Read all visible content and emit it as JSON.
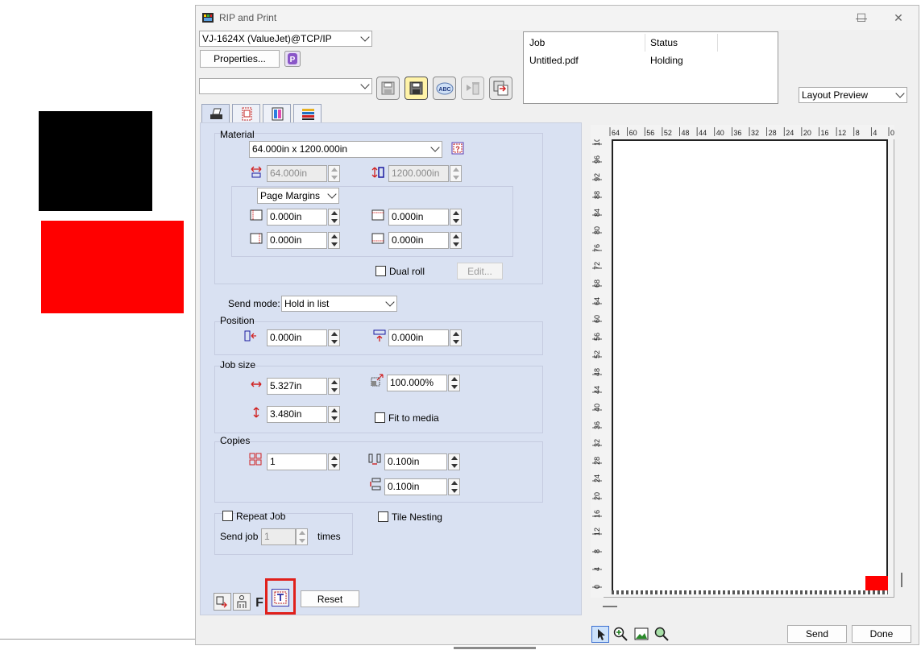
{
  "window": {
    "title": "RIP and Print",
    "controls": {
      "minimize": "—",
      "maximize": "☐",
      "close": "✕"
    }
  },
  "printer": {
    "selected": "VJ-1624X (ValueJet)@TCP/IP"
  },
  "properties_button": "Properties...",
  "settings_combo": {
    "selected": ""
  },
  "job_list": {
    "headers": [
      "Job",
      "Status"
    ],
    "rows": [
      {
        "job": "Untitled.pdf",
        "status": "Holding"
      }
    ]
  },
  "preview_mode": {
    "selected": "Layout Preview"
  },
  "material": {
    "label": "Material",
    "size": "64.000in x 1200.000in",
    "width": "64.000in",
    "height": "1200.000in",
    "margins_mode": "Page Margins",
    "margin_left": "0.000in",
    "margin_top": "0.000in",
    "margin_right": "0.000in",
    "margin_bottom": "0.000in",
    "dual_roll_label": "Dual roll",
    "dual_roll_checked": false,
    "edit_button": "Edit..."
  },
  "send_mode": {
    "label": "Send mode:",
    "selected": "Hold in list"
  },
  "position": {
    "label": "Position",
    "x": "0.000in",
    "y": "0.000in"
  },
  "job_size": {
    "label": "Job size",
    "width": "5.327in",
    "height": "3.480in",
    "scale": "100.000%",
    "fit_to_media_label": "Fit to media",
    "fit_to_media_checked": false
  },
  "copies": {
    "label": "Copies",
    "count": "1",
    "h_gap": "0.100in",
    "v_gap": "0.100in"
  },
  "repeat_job": {
    "label": "Repeat Job",
    "checked": false,
    "send_job_label": "Send job",
    "times_value": "1",
    "times_label": "times"
  },
  "tile_nesting": {
    "label": "Tile Nesting",
    "checked": false
  },
  "reset_button": "Reset",
  "send_button": "Send",
  "done_button": "Done",
  "ruler": {
    "top_labels": [
      "64",
      "60",
      "56",
      "52",
      "48",
      "44",
      "40",
      "36",
      "32",
      "28",
      "24",
      "20",
      "16",
      "12",
      "8",
      "4",
      "0"
    ],
    "left_labels": [
      "100",
      "96",
      "92",
      "88",
      "84",
      "80",
      "76",
      "72",
      "68",
      "64",
      "60",
      "56",
      "52",
      "48",
      "44",
      "40",
      "36",
      "32",
      "28",
      "24",
      "20",
      "16",
      "12",
      "8",
      "4",
      "0"
    ]
  },
  "colors": {
    "accent_highlight": "#e0201b",
    "panel_bg": "#d9e1f2",
    "job_preview": "#ff0000"
  }
}
